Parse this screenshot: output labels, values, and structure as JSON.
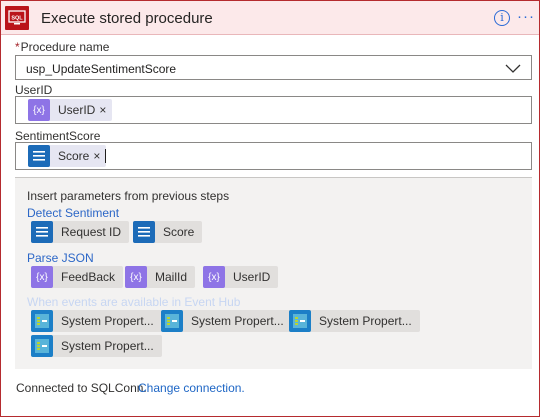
{
  "header": {
    "title": "Execute stored procedure",
    "icon_text": "SQL",
    "info_glyph": "i",
    "more_glyph": "···"
  },
  "procedure": {
    "required_mark": "*",
    "label": "Procedure name",
    "value": "usp_UpdateSentimentScore"
  },
  "userid_field": {
    "label": "UserID",
    "token_label": "UserID",
    "token_remove": "×"
  },
  "sentiment_field": {
    "label": "SentimentScore",
    "token_label": "Score",
    "token_remove": "×"
  },
  "dynamic_content": {
    "title": "Insert parameters from previous steps",
    "groups": [
      {
        "name": "Detect Sentiment",
        "items": [
          "Request ID",
          "Score"
        ]
      },
      {
        "name": "Parse JSON",
        "items": [
          "FeedBack",
          "MailId",
          "UserID"
        ]
      },
      {
        "name": "When events are available in Event Hub",
        "items": [
          "System Propert...",
          "System Propert...",
          "System Propert...",
          "System Propert..."
        ]
      }
    ]
  },
  "footer": {
    "connection_text": "Connected to SQLConn.",
    "change_link": "Change connection."
  },
  "colors": {
    "accent_red": "#ba141a",
    "link_blue": "#1e66c5",
    "token_purple": "#8e74e6",
    "token_blue": "#1c6bb8"
  },
  "icons": {
    "expression": "{x}",
    "list": "list-icon",
    "event_hub": "event-hub-icon"
  }
}
